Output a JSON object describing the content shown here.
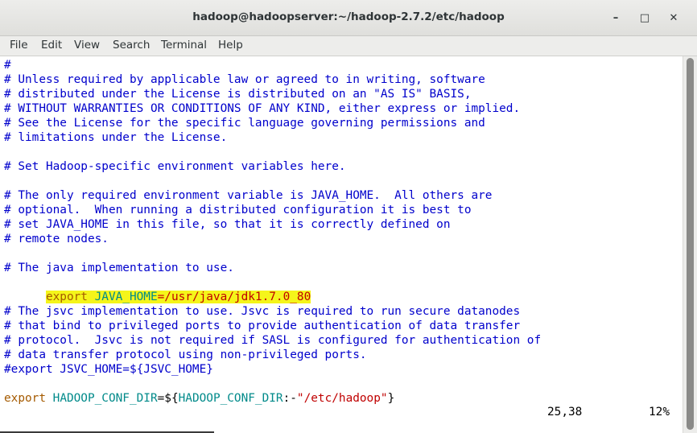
{
  "window": {
    "title": "hadoop@hadoopserver:~/hadoop-2.7.2/etc/hadoop",
    "minimize_glyph": "–",
    "maximize_glyph": "□",
    "close_glyph": "✕"
  },
  "menu": {
    "file": "File",
    "edit": "Edit",
    "view": "View",
    "search": "Search",
    "terminal": "Terminal",
    "help": "Help"
  },
  "editor": {
    "lines": [
      "#",
      "# Unless required by applicable law or agreed to in writing, software",
      "# distributed under the License is distributed on an \"AS IS\" BASIS,",
      "# WITHOUT WARRANTIES OR CONDITIONS OF ANY KIND, either express or implied.",
      "# See the License for the specific language governing permissions and",
      "# limitations under the License.",
      "",
      "# Set Hadoop-specific environment variables here.",
      "",
      "# The only required environment variable is JAVA_HOME.  All others are",
      "# optional.  When running a distributed configuration it is best to",
      "# set JAVA_HOME in this file, so that it is correctly defined on",
      "# remote nodes.",
      "",
      "# The java implementation to use.",
      "",
      "",
      "# The jsvc implementation to use. Jsvc is required to run secure datanodes",
      "# that bind to privileged ports to provide authentication of data transfer",
      "# protocol.  Jsvc is not required if SASL is configured for authentication of",
      "# data transfer protocol using non-privileged ports.",
      "#export JSVC_HOME=${JSVC_HOME}",
      "",
      ""
    ],
    "java_home_line": {
      "keyword": "export",
      "var": "JAVA_HOME",
      "value": "=/usr/java/jdk1.7.0_80"
    },
    "conf_dir_line": {
      "keyword": "export",
      "var": "HADOOP_CONF_DIR",
      "prefix": "=${",
      "inner_var": "HADOOP_CONF_DIR",
      "sep": ":-",
      "string": "\"/etc/hadoop\"",
      "suffix": "}"
    }
  },
  "status": {
    "position": "25,38",
    "percent": "12%"
  },
  "colors": {
    "comment": "#0000cc",
    "keyword": "#a55a00",
    "variable": "#008a8a",
    "string": "#c00000",
    "highlight": "#f5f51a"
  }
}
